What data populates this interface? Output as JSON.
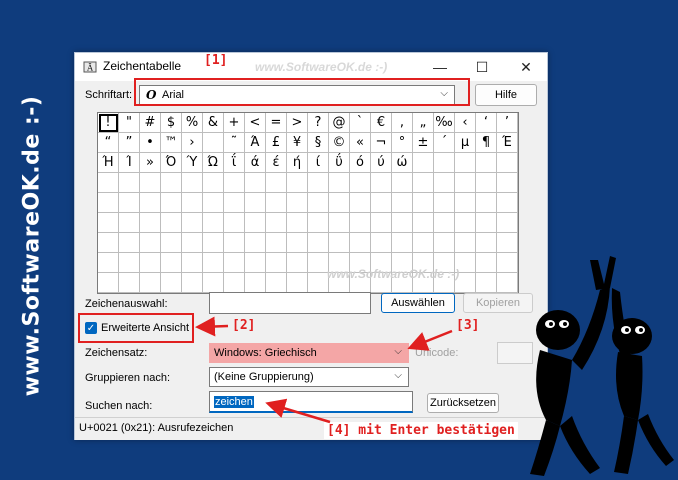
{
  "brand": {
    "side_text": "www.SoftwareOK.de :-)",
    "watermark_top": "www.SoftwareOK.de :-)",
    "watermark_grid": "www.SoftwareOK.de :-)"
  },
  "window": {
    "title": "Zeichentabelle",
    "minimize_label": "—",
    "maximize_label": "☐",
    "close_label": "✕"
  },
  "font_row": {
    "label": "Schriftart:",
    "value": "Arial",
    "font_glyph": "O",
    "help_button": "Hilfe"
  },
  "chars": [
    "!",
    "\"",
    "#",
    "$",
    "%",
    "&",
    "+",
    "<",
    "=",
    ">",
    "?",
    "@",
    "`",
    "€",
    ",",
    "„",
    "‰",
    "‹",
    "‘",
    "’",
    "“",
    "”",
    "•",
    "™",
    "›",
    "",
    "˜",
    "Ά",
    "£",
    "¥",
    "§",
    "©",
    "«",
    "¬",
    "°",
    "±",
    "´",
    "µ",
    "¶",
    "Έ",
    "Ή",
    "Ί",
    "»",
    "Ό",
    "Ύ",
    "Ώ",
    "ΐ",
    "ά",
    "έ",
    "ή",
    "ί",
    "ΰ",
    "ό",
    "ύ",
    "ώ",
    "",
    "",
    "",
    "",
    "",
    "",
    "",
    "",
    "",
    "",
    "",
    "",
    "",
    "",
    "",
    "",
    "",
    "",
    "",
    "",
    "",
    "",
    "",
    "",
    "",
    "",
    "",
    "",
    "",
    "",
    "",
    "",
    "",
    "",
    "",
    "",
    "",
    "",
    "",
    "",
    "",
    "",
    "",
    "",
    "",
    "",
    "",
    "",
    "",
    "",
    "",
    "",
    "",
    "",
    "",
    "",
    "",
    "",
    "",
    "",
    "",
    "",
    "",
    "",
    "",
    "",
    "",
    "",
    "",
    "",
    "",
    "",
    "",
    "",
    "",
    "",
    "",
    "",
    "",
    "",
    "",
    "",
    "",
    "",
    "",
    "",
    "",
    "",
    "",
    "",
    "",
    "",
    "",
    "",
    "",
    "",
    "",
    "",
    "",
    "",
    "",
    "",
    "",
    "",
    "",
    "",
    "",
    "",
    "",
    "",
    "",
    "",
    "",
    "",
    "",
    "",
    "",
    "",
    "",
    "",
    "",
    "",
    "",
    "",
    ""
  ],
  "selection": {
    "label": "Zeichenauswahl:",
    "value": "",
    "select_button": "Auswählen",
    "copy_button": "Kopieren"
  },
  "advanced": {
    "label": "Erweiterte Ansicht",
    "checked": true
  },
  "charset": {
    "label": "Zeichensatz:",
    "value": "Windows: Griechisch",
    "unicode_label": "Unicode:",
    "unicode_value": ""
  },
  "group": {
    "label": "Gruppieren nach:",
    "value": "(Keine Gruppierung)"
  },
  "search": {
    "label": "Suchen nach:",
    "value": "zeichen",
    "reset_button": "Zurücksetzen"
  },
  "status": "U+0021 (0x21): Ausrufezeichen",
  "annotations": {
    "a1": "[1]",
    "a2": "[2]",
    "a3": "[3]",
    "a4": "[4] mit Enter bestätigen"
  },
  "colors": {
    "accent": "#0067c0",
    "annotation": "#e02020",
    "background": "#0f3c7d",
    "charset_highlight": "#f4a6a6"
  }
}
